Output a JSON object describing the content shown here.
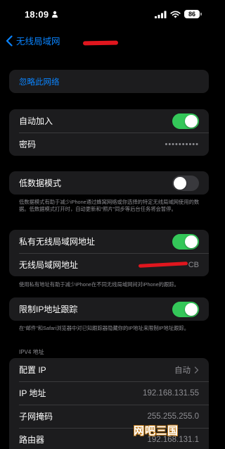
{
  "status_bar": {
    "time": "18:09",
    "battery": "86",
    "person_icon": "person-icon",
    "signal_icon": "signal-icon",
    "wifi_icon": "wifi-icon"
  },
  "nav": {
    "back_label": "无线局域网",
    "back_icon": "chevron-left-icon"
  },
  "forget": {
    "label": "忽略此网络"
  },
  "auto_join": {
    "label": "自动加入",
    "toggle_on": true
  },
  "password": {
    "label": "密码",
    "masked_value": "••••••••••"
  },
  "low_data": {
    "label": "低数据模式",
    "toggle_on": false,
    "footnote": "低数据模式有助于减少iPhone通过蜂窝网络或你选择的特定无线局域网使用的数据。低数据模式打开时，自动更新和“照片”同步等后台任务将会暂停。"
  },
  "private_address": {
    "label": "私有无线局域网地址",
    "toggle_on": true
  },
  "wifi_address": {
    "label": "无线局域网地址",
    "value_tail": "CB",
    "footnote": "使用私有地址有助于减少iPhone在不同无线局域网间对iPhone的跟踪。"
  },
  "limit_ip": {
    "label": "限制IP地址跟踪",
    "toggle_on": true,
    "footnote": "在“邮件”和Safari浏览器中对已知跟踪器隐藏你的IP地址来限制IP地址跟踪。"
  },
  "ipv4": {
    "header": "IPV4 地址",
    "configure_label": "配置 IP",
    "configure_value": "自动",
    "ip_label": "IP 地址",
    "ip_value": "192.168.131.55",
    "subnet_label": "子网掩码",
    "subnet_value": "255.255.255.0",
    "router_label": "路由器",
    "router_value": "192.168.131.1"
  },
  "watermark": "网吧三国",
  "colors": {
    "accent_blue": "#0a84ff",
    "toggle_green": "#34c759",
    "redaction_red": "#e0161e",
    "cell_bg": "#1c1c1e"
  }
}
